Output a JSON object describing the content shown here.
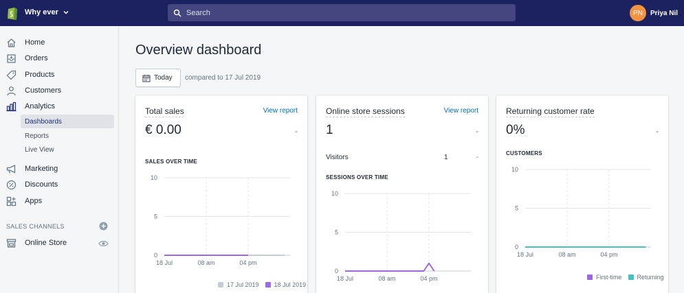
{
  "topbar": {
    "store_name": "Why ever",
    "search_placeholder": "Search",
    "user_initials": "PN",
    "user_name": "Priya Nil"
  },
  "sidebar": {
    "items": [
      {
        "label": "Home",
        "icon": "home-icon"
      },
      {
        "label": "Orders",
        "icon": "orders-icon"
      },
      {
        "label": "Products",
        "icon": "tag-icon"
      },
      {
        "label": "Customers",
        "icon": "person-icon"
      },
      {
        "label": "Analytics",
        "icon": "bar-chart-icon"
      },
      {
        "label": "Marketing",
        "icon": "megaphone-icon"
      },
      {
        "label": "Discounts",
        "icon": "discount-icon"
      },
      {
        "label": "Apps",
        "icon": "apps-icon"
      }
    ],
    "analytics_sub": [
      "Dashboards",
      "Reports",
      "Live View"
    ],
    "active_sub": "Dashboards",
    "channels_title": "SALES CHANNELS",
    "online_store": "Online Store"
  },
  "main": {
    "title": "Overview dashboard",
    "date_button": "Today",
    "compared_text": "compared to 17 Jul 2019"
  },
  "cards": {
    "total_sales": {
      "title": "Total sales",
      "link": "View report",
      "value": "€ 0.00",
      "delta": "-",
      "chart_title": "SALES OVER TIME",
      "legend": [
        "17 Jul 2019",
        "18 Jul 2019"
      ]
    },
    "sessions": {
      "title": "Online store sessions",
      "link": "View report",
      "value": "1",
      "delta": "-",
      "row_label": "Visitors",
      "row_value": "1",
      "row_delta": "-",
      "chart_title": "SESSIONS OVER TIME"
    },
    "returning": {
      "title": "Returning customer rate",
      "value": "0%",
      "delta": "-",
      "chart_title": "CUSTOMERS",
      "legend": [
        "First-time",
        "Returning"
      ]
    }
  },
  "colors": {
    "topbar": "#1c2260",
    "current_series": "#9c6ade",
    "previous_series": "#c4cdd5",
    "returning_series": "#47c1bf",
    "link": "#006fbb"
  },
  "chart_data": [
    {
      "type": "line",
      "title": "SALES OVER TIME",
      "x_ticks": [
        "18 Jul",
        "08 am",
        "04 pm"
      ],
      "y_ticks": [
        0,
        5,
        10
      ],
      "ylim": [
        0,
        10
      ],
      "x_hours": [
        0,
        8,
        16,
        23
      ],
      "series": [
        {
          "name": "17 Jul 2019",
          "values": [
            0,
            0,
            0,
            0
          ]
        },
        {
          "name": "18 Jul 2019",
          "values": [
            0,
            0,
            0
          ]
        }
      ],
      "legend": "bottom-right",
      "grid": true
    },
    {
      "type": "line",
      "title": "SESSIONS OVER TIME",
      "x_ticks": [
        "18 Jul",
        "08 am",
        "04 pm"
      ],
      "y_ticks": [
        0,
        5,
        10
      ],
      "ylim": [
        0,
        10
      ],
      "x_hours": [
        0,
        15,
        16,
        17
      ],
      "series": [
        {
          "values": [
            0,
            0,
            1,
            0
          ]
        }
      ],
      "grid": true
    },
    {
      "type": "line",
      "title": "CUSTOMERS",
      "x_ticks": [
        "18 Jul",
        "08 am",
        "04 pm"
      ],
      "y_ticks": [
        0,
        5,
        10
      ],
      "ylim": [
        0,
        10
      ],
      "x_hours": [
        0,
        23
      ],
      "series": [
        {
          "name": "First-time",
          "values": [
            0,
            0
          ]
        },
        {
          "name": "Returning",
          "values": [
            0,
            0
          ]
        }
      ],
      "legend": "bottom-right",
      "grid": true
    }
  ]
}
